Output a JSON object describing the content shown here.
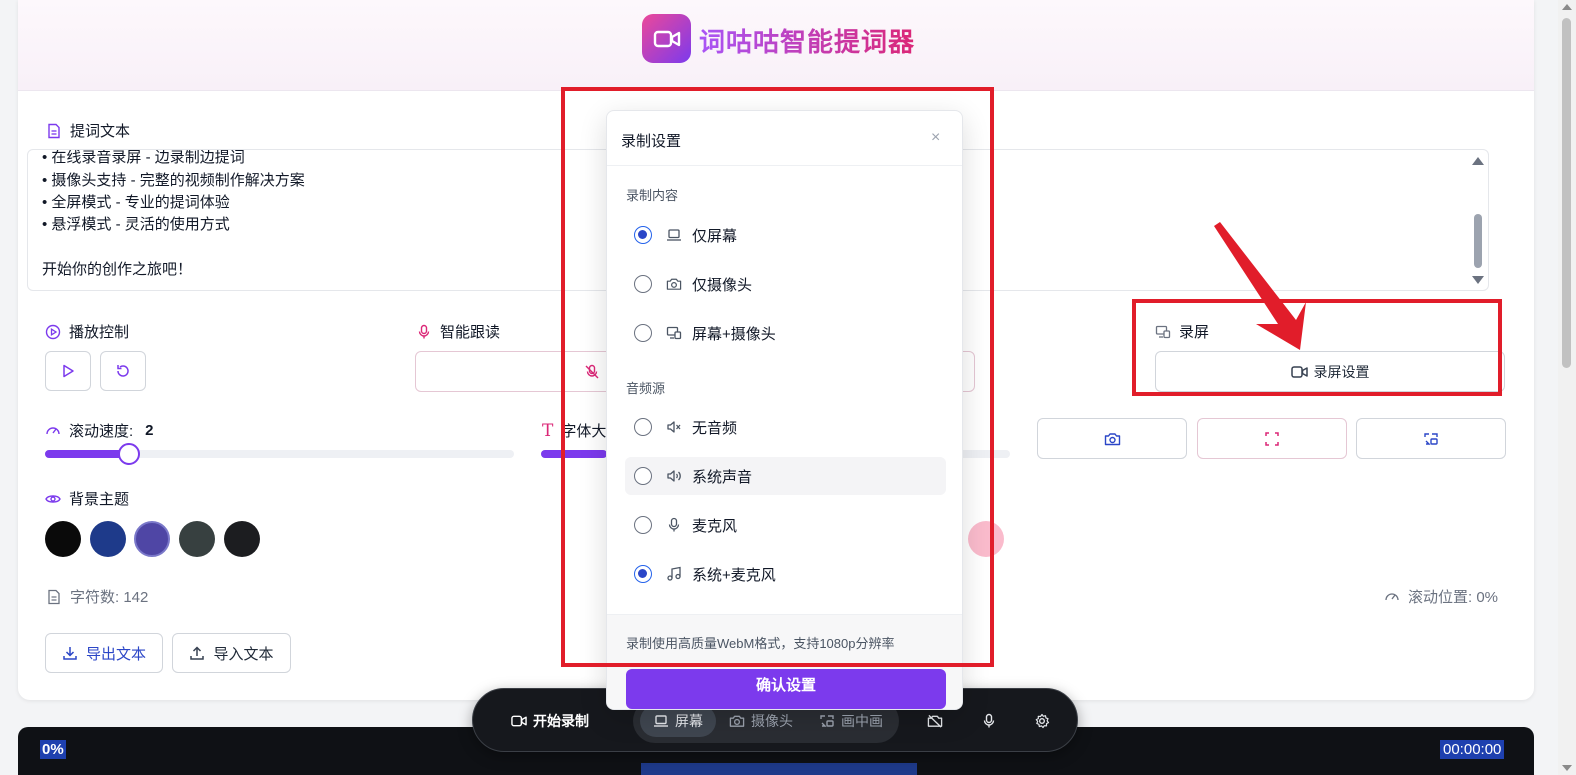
{
  "app": {
    "title": "词咕咕智能提词器"
  },
  "prompt": {
    "label": "提词文本",
    "lines": [
      "• 在线录音录屏 - 边录制边提词",
      "• 摄像头支持 - 完整的视频制作解决方案",
      "• 全屏模式 - 专业的提词体验",
      "• 悬浮模式 - 灵活的使用方式",
      "",
      "开始你的创作之旅吧！"
    ]
  },
  "playback": {
    "label": "播放控制"
  },
  "smart_follow": {
    "label": "智能跟读"
  },
  "record": {
    "label": "录屏",
    "settings_button": "录屏设置"
  },
  "speed": {
    "label": "滚动速度:",
    "value": "2",
    "fraction": 0.18
  },
  "font_size": {
    "label": "字体大",
    "fraction": 0.14
  },
  "theme": {
    "label": "背景主题",
    "colors": [
      "#0a0a0a",
      "#1e3a8a",
      "#4f46a5",
      "#374040",
      "#1c1d20"
    ]
  },
  "stats": {
    "chars": "字符数: 142",
    "scroll_pos": "滚动位置: 0%"
  },
  "actions": {
    "export": "导出文本",
    "import": "导入文本"
  },
  "modal": {
    "title": "录制设置",
    "close": "×",
    "content_group": "录制内容",
    "content_options": [
      {
        "label": "仅屏幕",
        "icon": "laptop-icon",
        "checked": true
      },
      {
        "label": "仅摄像头",
        "icon": "camera-icon",
        "checked": false
      },
      {
        "label": "屏幕+摄像头",
        "icon": "screen-camera-icon",
        "checked": false
      }
    ],
    "audio_group": "音频源",
    "audio_options": [
      {
        "label": "无音频",
        "icon": "volume-mute-icon",
        "checked": false
      },
      {
        "label": "系统声音",
        "icon": "volume-icon",
        "checked": false
      },
      {
        "label": "麦克风",
        "icon": "mic-icon",
        "checked": false
      },
      {
        "label": "系统+麦克风",
        "icon": "music-icon",
        "checked": true
      }
    ],
    "note": "录制使用高质量WebM格式，支持1080p分辨率",
    "confirm": "确认设置"
  },
  "toolbar": {
    "start": "开始录制",
    "screen": "屏幕",
    "camera": "摄像头",
    "pip": "画中画"
  },
  "preview": {
    "percent": "0%",
    "time": "00:00:00"
  },
  "colors": {
    "accent": "#7c3aed",
    "annotation": "#e11d2a"
  }
}
